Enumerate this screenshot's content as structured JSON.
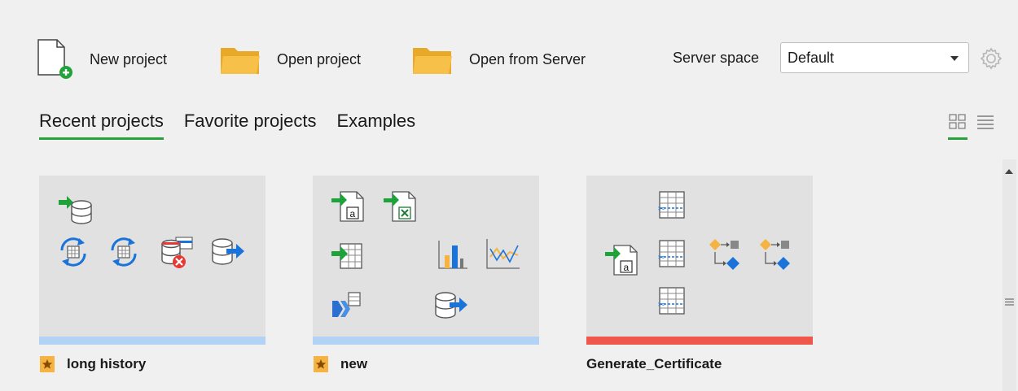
{
  "toolbar": {
    "new_project": "New project",
    "open_project": "Open project",
    "open_from_server": "Open from Server",
    "server_space_label": "Server space",
    "server_space_value": "Default"
  },
  "tabs": [
    {
      "label": "Recent projects",
      "active": true
    },
    {
      "label": "Favorite projects",
      "active": false
    },
    {
      "label": "Examples",
      "active": false
    }
  ],
  "view_modes": [
    "grid-view-icon",
    "list-view-icon"
  ],
  "projects": [
    {
      "title": "long history",
      "favorite": true,
      "status_color": "#b3d3f5"
    },
    {
      "title": "new",
      "favorite": true,
      "status_color": "#b3d3f5"
    },
    {
      "title": "Generate_Certificate",
      "favorite": false,
      "status_color": "#f0574c"
    }
  ],
  "colors": {
    "accent_green": "#27a139",
    "folder_yellow": "#f7c048",
    "card_bg": "#e1e1e1",
    "status_blue": "#b3d3f5",
    "status_red": "#f0574c",
    "star_orange": "#f5b342",
    "icon_blue": "#1a73d9"
  }
}
